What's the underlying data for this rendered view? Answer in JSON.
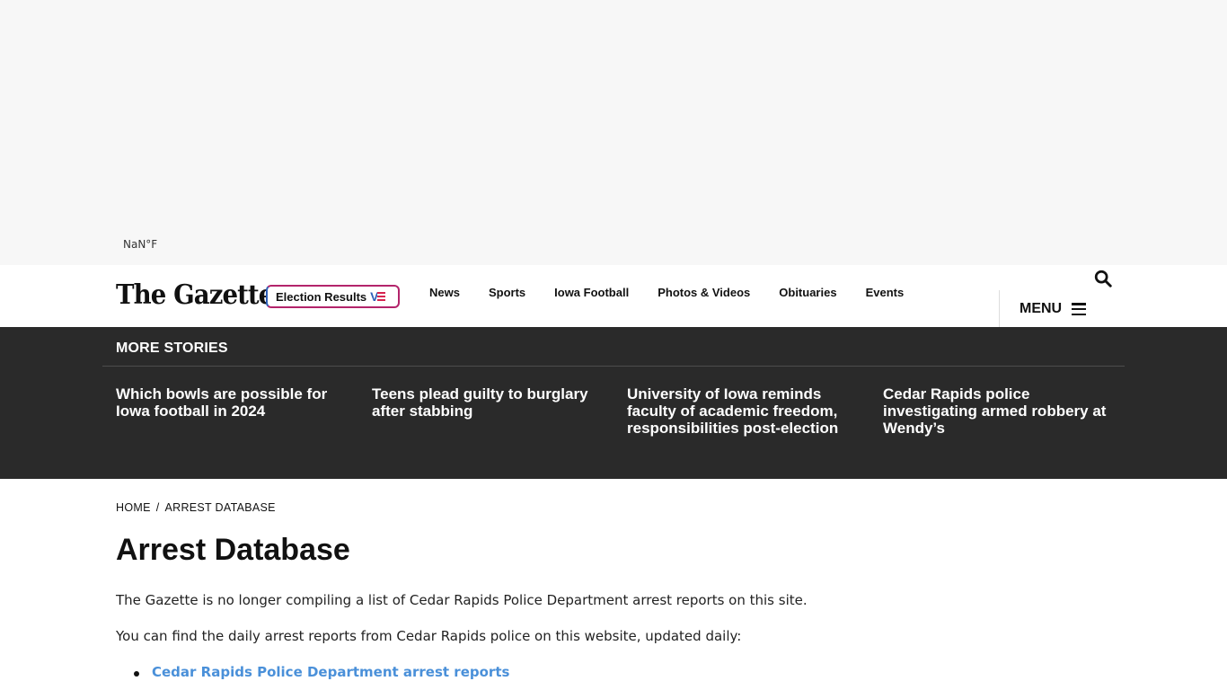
{
  "weather": {
    "temp": "NaN°F"
  },
  "header": {
    "logo": "The Gazette",
    "election_label": "Election Results",
    "nav": [
      "News",
      "Sports",
      "Iowa Football",
      "Photos & Videos",
      "Obituaries",
      "Events"
    ],
    "menu_label": "MENU"
  },
  "more_stories": {
    "title": "MORE STORIES",
    "items": [
      "Which bowls are possible for Iowa football in 2024",
      "Teens plead guilty to burglary after stabbing",
      "University of Iowa reminds faculty of academic freedom, responsibilities post-election",
      "Cedar Rapids police investigating armed robbery at Wendy’s"
    ]
  },
  "breadcrumb": {
    "home": "HOME",
    "separator": "/",
    "current": "ARREST DATABASE"
  },
  "page": {
    "title": "Arrest Database",
    "paragraphs": [
      "The Gazette is no longer compiling a list of Cedar Rapids Police Department arrest reports on this site.",
      "You can find the daily arrest reports from Cedar Rapids police on this website, updated daily:"
    ],
    "links": [
      "Cedar Rapids Police Department arrest reports"
    ]
  },
  "colors": {
    "dark_band": "#2a2a2a",
    "link": "#4a90d9",
    "election_border": "#b3246b"
  },
  "icons": {
    "search": "search-icon",
    "menu": "hamburger-icon",
    "election": "flag-icon"
  }
}
